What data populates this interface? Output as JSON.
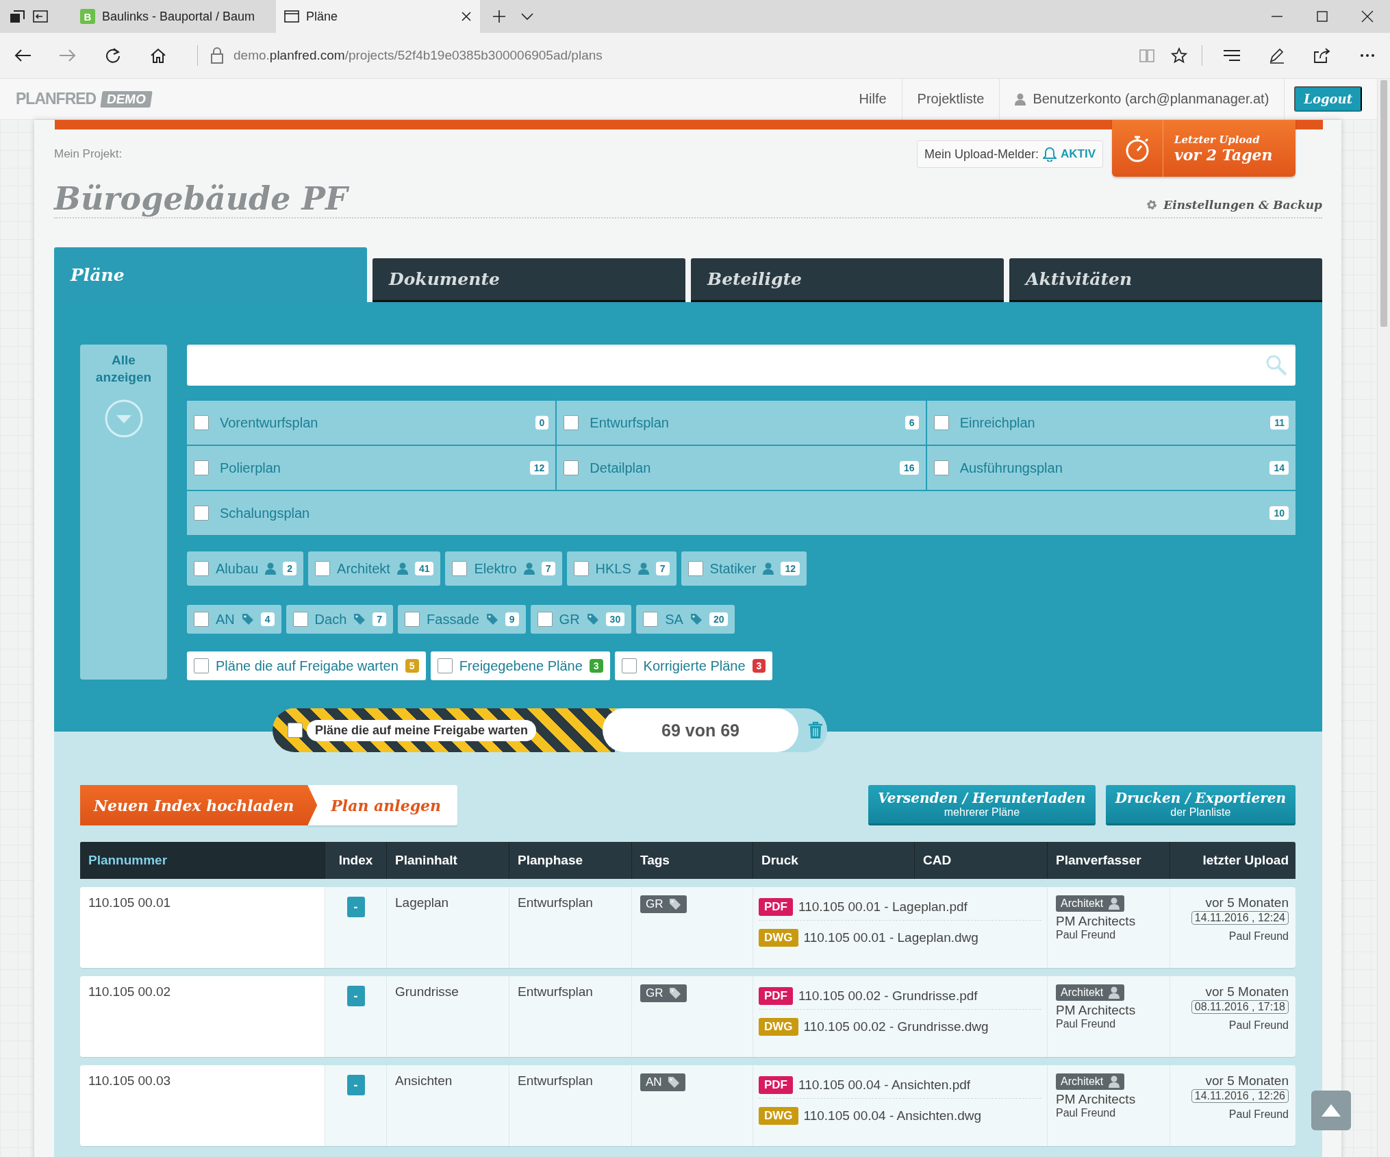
{
  "browser": {
    "tabs": [
      {
        "favicon": "B",
        "title": "Baulinks - Bauportal / Baum",
        "selected": false
      },
      {
        "title": "Pläne",
        "selected": true
      }
    ],
    "url": {
      "subdomain": "demo.",
      "domain": "planfred.com",
      "path": "/projects/52f4b19e0385b300006905ad/plans"
    }
  },
  "site_header": {
    "logo": "PLANFRED",
    "logo_badge": "DEMO",
    "nav": [
      "Hilfe",
      "Projektliste"
    ],
    "account": "Benutzerkonto (arch@planmanager.at)",
    "logout": "Logout"
  },
  "project": {
    "label": "Mein Projekt:",
    "title": "Bürogebäude PF",
    "upload_alert": {
      "label": "Mein Upload-Melder:",
      "status": "AKTIV",
      "on": true
    },
    "last_upload": {
      "label": "Letzter Upload",
      "value": "vor 2 Tagen"
    },
    "settings": "Einstellungen & Backup"
  },
  "tabs": [
    {
      "label": "Pläne",
      "selected": true
    },
    {
      "label": "Dokumente",
      "selected": false
    },
    {
      "label": "Beteiligte",
      "selected": false
    },
    {
      "label": "Aktivitäten",
      "selected": false
    }
  ],
  "filters": {
    "show_all": "Alle anzeigen",
    "phases": [
      {
        "label": "Vorentwurfsplan",
        "count": "0",
        "checked": false
      },
      {
        "label": "Entwurfsplan",
        "count": "6",
        "checked": false
      },
      {
        "label": "Einreichplan",
        "count": "11",
        "checked": false
      },
      {
        "label": "Polierplan",
        "count": "12",
        "checked": false
      },
      {
        "label": "Detailplan",
        "count": "16",
        "checked": false
      },
      {
        "label": "Ausführungsplan",
        "count": "14",
        "checked": false
      },
      {
        "label": "Schalungsplan",
        "count": "10",
        "checked": false
      }
    ],
    "groups": [
      {
        "label": "Alubau",
        "count": "2",
        "checked": false
      },
      {
        "label": "Architekt",
        "count": "41",
        "checked": false
      },
      {
        "label": "Elektro",
        "count": "7",
        "checked": false
      },
      {
        "label": "HKLS",
        "count": "7",
        "checked": false
      },
      {
        "label": "Statiker",
        "count": "12",
        "checked": false
      }
    ],
    "tags": [
      {
        "label": "AN",
        "count": "4",
        "checked": false
      },
      {
        "label": "Dach",
        "count": "7",
        "checked": false
      },
      {
        "label": "Fassade",
        "count": "9",
        "checked": false
      },
      {
        "label": "GR",
        "count": "30",
        "checked": false
      },
      {
        "label": "SA",
        "count": "20",
        "checked": false
      }
    ],
    "statuses": [
      {
        "label": "Pläne die auf Freigabe warten",
        "count": "5",
        "color": "#d4a21c",
        "checked": false
      },
      {
        "label": "Freigegebene Pläne",
        "count": "3",
        "color": "#3aa637",
        "checked": false
      },
      {
        "label": "Korrigierte Pläne",
        "count": "3",
        "color": "#d9393e",
        "checked": false
      }
    ],
    "my_approval": {
      "label": "Pläne die auf meine Freigabe warten",
      "checked": false
    },
    "result_count": "69 von 69"
  },
  "actions": {
    "upload": "Neuen Index hochladen",
    "create": "Plan anlegen",
    "buttons": [
      {
        "title": "Versenden / Herunterladen",
        "subtitle": "mehrerer Pläne"
      },
      {
        "title": "Drucken / Exportieren",
        "subtitle": "der Planliste"
      }
    ]
  },
  "table": {
    "columns": [
      {
        "label": "Plannummer",
        "sorted": true
      },
      {
        "label": "Index",
        "sorted": false
      },
      {
        "label": "Planinhalt",
        "sorted": false
      },
      {
        "label": "Planphase",
        "sorted": false
      },
      {
        "label": "Tags",
        "sorted": false
      },
      {
        "label": "Druck",
        "sorted": false
      },
      {
        "label": "CAD",
        "sorted": false
      },
      {
        "label": "Planverfasser",
        "sorted": false
      },
      {
        "label": "letzter Upload",
        "sorted": false
      }
    ],
    "rows": [
      {
        "number": "110.105 00.01",
        "index": "-",
        "content": "Lageplan",
        "phase": "Entwurfsplan",
        "tag": "GR",
        "files": [
          {
            "kind": "pdf",
            "badge": "PDF",
            "name": "110.105 00.01 - Lageplan.pdf"
          },
          {
            "kind": "dwg",
            "badge": "DWG",
            "name": "110.105 00.01 - Lageplan.dwg"
          }
        ],
        "author": {
          "role": "Architekt",
          "company": "PM Architects",
          "person": "Paul Freund"
        },
        "upload": {
          "ago": "vor 5 Monaten",
          "date": "14.11.2016 , 12:24",
          "user": "Paul Freund"
        }
      },
      {
        "number": "110.105 00.02",
        "index": "-",
        "content": "Grundrisse",
        "phase": "Entwurfsplan",
        "tag": "GR",
        "files": [
          {
            "kind": "pdf",
            "badge": "PDF",
            "name": "110.105 00.02 - Grundrisse.pdf"
          },
          {
            "kind": "dwg",
            "badge": "DWG",
            "name": "110.105 00.02 - Grundrisse.dwg"
          }
        ],
        "author": {
          "role": "Architekt",
          "company": "PM Architects",
          "person": "Paul Freund"
        },
        "upload": {
          "ago": "vor 5 Monaten",
          "date": "08.11.2016 , 17:18",
          "user": "Paul Freund"
        }
      },
      {
        "number": "110.105 00.03",
        "index": "-",
        "content": "Ansichten",
        "phase": "Entwurfsplan",
        "tag": "AN",
        "files": [
          {
            "kind": "pdf",
            "badge": "PDF",
            "name": "110.105 00.04 - Ansichten.pdf"
          },
          {
            "kind": "dwg",
            "badge": "DWG",
            "name": "110.105 00.04 - Ansichten.dwg"
          }
        ],
        "author": {
          "role": "Architekt",
          "company": "PM Architects",
          "person": "Paul Freund"
        },
        "upload": {
          "ago": "vor 5 Monaten",
          "date": "14.11.2016 , 12:26",
          "user": "Paul Freund"
        }
      }
    ]
  }
}
